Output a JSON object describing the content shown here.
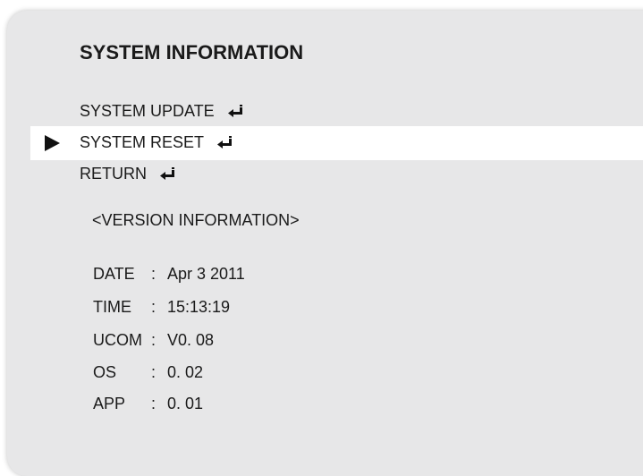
{
  "screen": {
    "title": "SYSTEM INFORMATION"
  },
  "menu": {
    "items": [
      {
        "label": "SYSTEM UPDATE",
        "icon": "enter-icon"
      },
      {
        "label": "SYSTEM RESET",
        "icon": "enter-icon",
        "selected": true
      },
      {
        "label": "RETURN",
        "icon": "enter-icon"
      }
    ]
  },
  "version": {
    "header": "<VERSION INFORMATION>",
    "separator": ":",
    "rows": [
      {
        "key": "DATE",
        "value": "Apr 3 2011"
      },
      {
        "key": "TIME",
        "value": "15:13:19"
      },
      {
        "key": "UCOM",
        "value": "V0. 08"
      },
      {
        "key": "OS",
        "value": "0. 02"
      },
      {
        "key": "APP",
        "value": "0. 01"
      }
    ]
  },
  "colors": {
    "panel": "#e7e7e8",
    "selection": "#ffffff",
    "text": "#1a1a1a"
  }
}
